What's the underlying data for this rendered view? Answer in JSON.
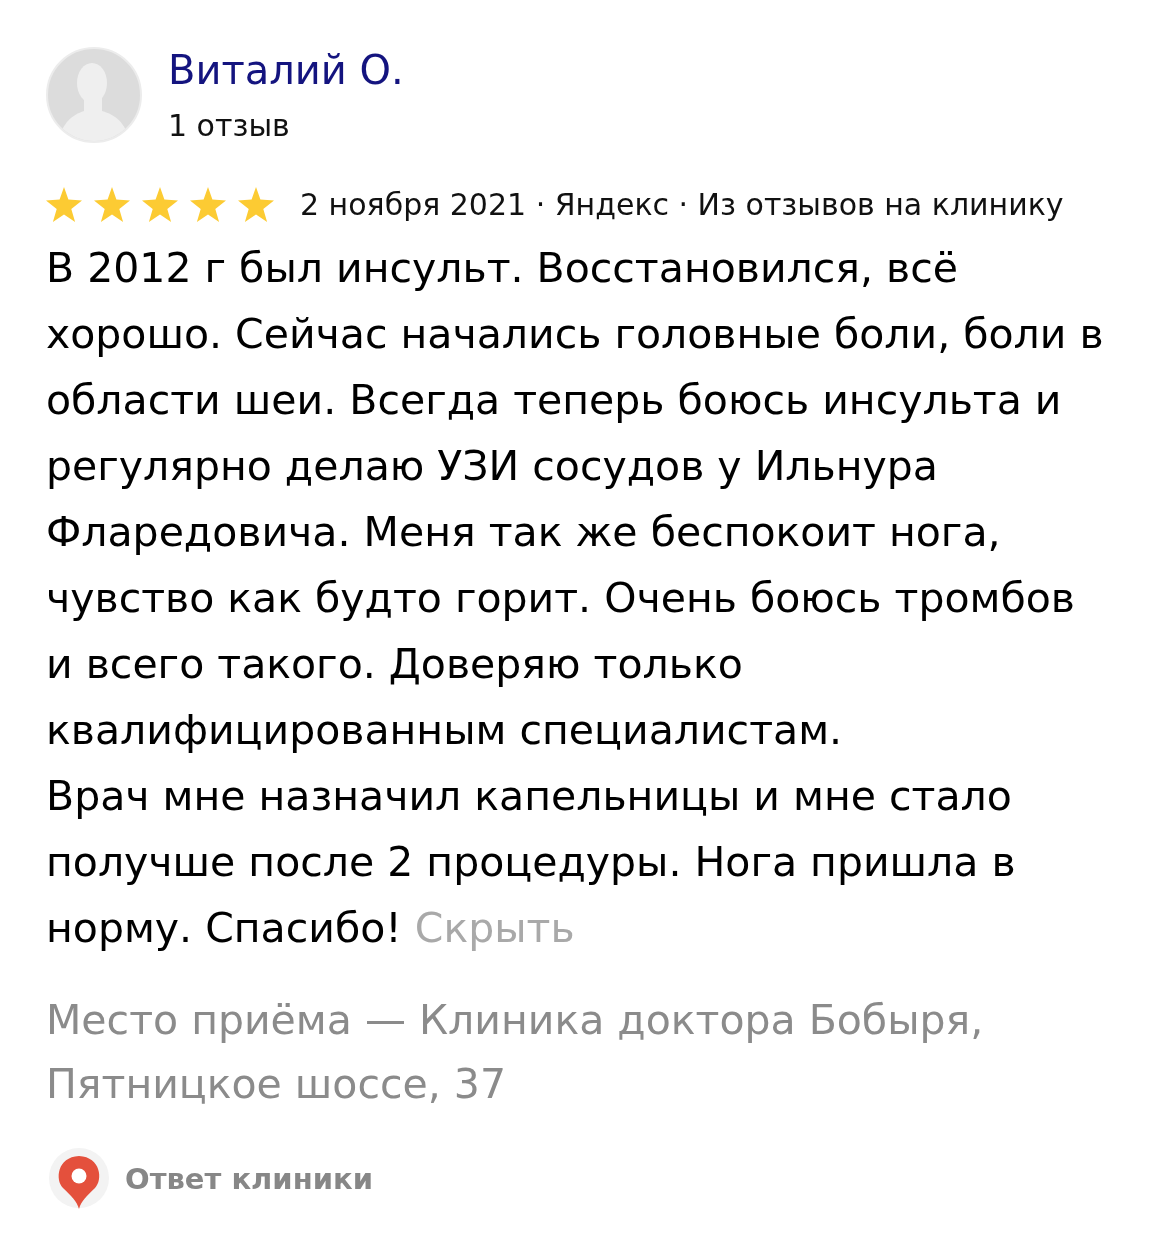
{
  "author": {
    "name": "Виталий О.",
    "review_count": "1 отзыв"
  },
  "review": {
    "stars": 5,
    "meta": "2 ноября 2021 · Яндекс · Из отзывов на клинику",
    "paragraphs": [
      "В 2012 г был инсульт. Восстановился, всё хорошо. Сейчас начались головные боли, боли в области шеи. Всегда теперь боюсь инсульта и регулярно делаю УЗИ сосудов у Ильнура Фларедовича. Меня так же беспокоит нога, чувство как будто горит. Очень боюсь тромбов и всего такого. Доверяю только квалифицированным специалистам.",
      "Врач мне назначил капельницы и мне стало получше после 2 процедуры. Нога пришла в норму. Спасибо!"
    ],
    "hide_link": "Скрыть"
  },
  "location": "Место приёма — Клиника доктора Бобыря, Пятницкое шоссе, 37",
  "clinic_reply": {
    "label": "Ответ клиники"
  }
}
